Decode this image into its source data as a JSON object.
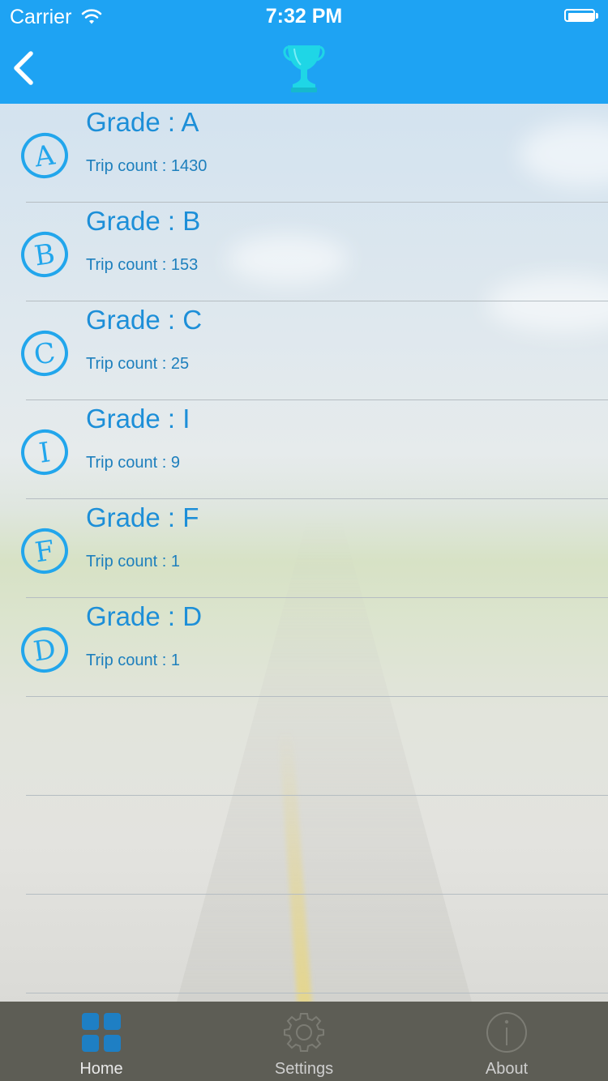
{
  "status_bar": {
    "carrier": "Carrier",
    "time": "7:32 PM"
  },
  "nav": {
    "back_icon": "chevron-left-icon",
    "title_icon": "trophy-icon",
    "title_icon_color": "#1fd6e6"
  },
  "grades": [
    {
      "letter": "A",
      "title": "Grade : A",
      "trip_count": "Trip count : 1430"
    },
    {
      "letter": "B",
      "title": "Grade : B",
      "trip_count": "Trip count : 153"
    },
    {
      "letter": "C",
      "title": "Grade : C",
      "trip_count": "Trip count : 25"
    },
    {
      "letter": "I",
      "title": "Grade : I",
      "trip_count": "Trip count : 9"
    },
    {
      "letter": "F",
      "title": "Grade : F",
      "trip_count": "Trip count : 1"
    },
    {
      "letter": "D",
      "title": "Grade : D",
      "trip_count": "Trip count : 1"
    },
    {
      "letter": "",
      "title": "",
      "trip_count": ""
    },
    {
      "letter": "",
      "title": "",
      "trip_count": ""
    },
    {
      "letter": "",
      "title": "",
      "trip_count": ""
    }
  ],
  "tabbar": {
    "tabs": [
      {
        "label": "Home",
        "icon": "grid-icon",
        "active": true
      },
      {
        "label": "Settings",
        "icon": "gear-icon",
        "active": false
      },
      {
        "label": "About",
        "icon": "info-icon",
        "active": false
      }
    ]
  },
  "colors": {
    "nav_bar": "#1ea3f3",
    "grade_blue": "#1d8fd8",
    "tab_bar": "#5d5d55"
  }
}
